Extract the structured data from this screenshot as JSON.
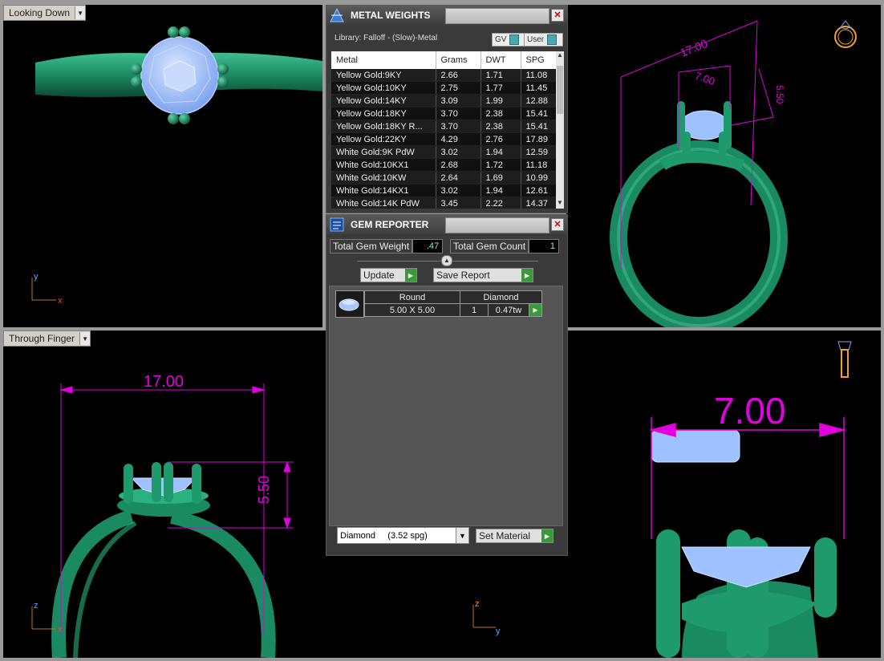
{
  "viewports": {
    "top_left": {
      "label": "Looking Down"
    },
    "bottom_left": {
      "label": "Through Finger"
    }
  },
  "dimensions": {
    "tr_width": "17.00",
    "tr_stone": "7.00",
    "tr_height": "5.50",
    "bl_width": "17.00",
    "bl_height": "5.50",
    "br_stone": "7.00"
  },
  "axes": {
    "x": "x",
    "y": "y",
    "z": "z"
  },
  "metal_weights": {
    "title": "METAL WEIGHTS",
    "library": "Library: Falloff - (Slow)-Metal",
    "gv_label": "GV",
    "user_label": "User",
    "columns": [
      "Metal",
      "Grams",
      "DWT",
      "SPG"
    ],
    "rows": [
      [
        "Yellow Gold:9KY",
        "2.66",
        "1.71",
        "11.08"
      ],
      [
        "Yellow Gold:10KY",
        "2.75",
        "1.77",
        "11.45"
      ],
      [
        "Yellow Gold:14KY",
        "3.09",
        "1.99",
        "12.88"
      ],
      [
        "Yellow Gold:18KY",
        "3.70",
        "2.38",
        "15.41"
      ],
      [
        "Yellow Gold:18KY R...",
        "3.70",
        "2.38",
        "15.41"
      ],
      [
        "Yellow Gold:22KY",
        "4.29",
        "2.76",
        "17.89"
      ],
      [
        "White Gold:9K PdW",
        "3.02",
        "1.94",
        "12.59"
      ],
      [
        "White Gold:10KX1",
        "2.68",
        "1.72",
        "11.18"
      ],
      [
        "White Gold:10KW",
        "2.64",
        "1.69",
        "10.99"
      ],
      [
        "White Gold:14KX1",
        "3.02",
        "1.94",
        "12.61"
      ],
      [
        "White Gold:14K PdW",
        "3.45",
        "2.22",
        "14.37"
      ]
    ]
  },
  "gem_reporter": {
    "title": "GEM REPORTER",
    "total_weight_label": "Total Gem Weight",
    "total_weight": ".47",
    "total_count_label": "Total Gem Count",
    "total_count": "1",
    "update_label": "Update",
    "save_report_label": "Save Report",
    "gem": {
      "shape": "Round",
      "material": "Diamond",
      "size": "5.00 X 5.00",
      "count": "1",
      "weight": "0.47tw"
    },
    "material_select": "Diamond     (3.52 spg)",
    "set_material_label": "Set Material"
  },
  "colors": {
    "metal": "#1f8f6a",
    "gem": "#9ec2ff",
    "dimension": "#e000e0"
  }
}
